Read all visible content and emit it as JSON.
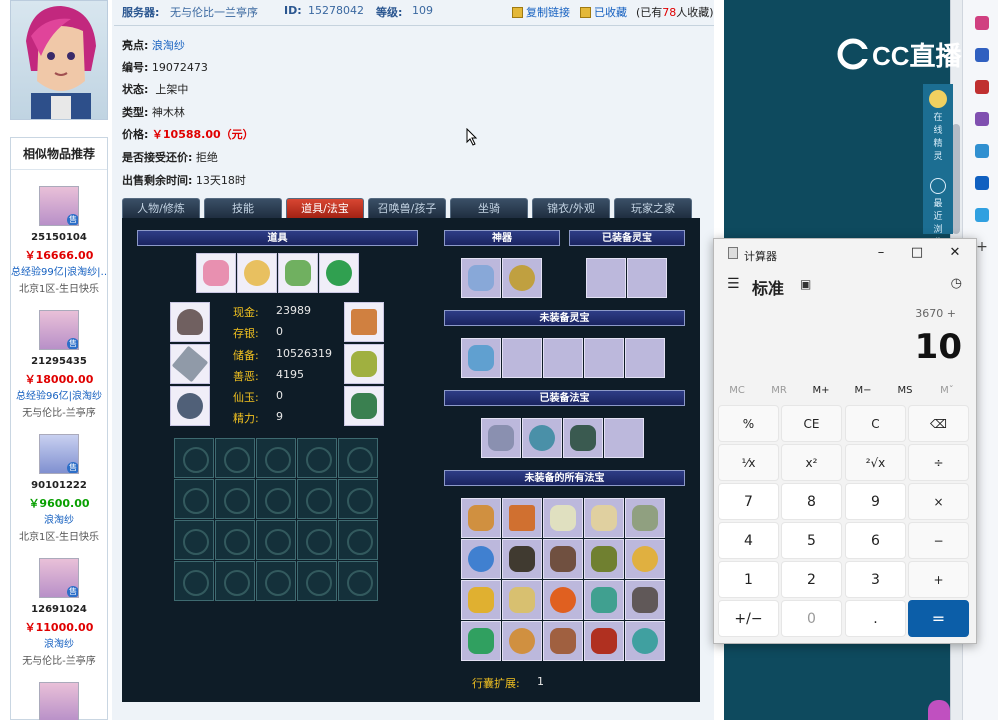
{
  "product": {
    "server_label": "服务器:",
    "server_value": "无与伦比一兰亭序",
    "id_label": "ID:",
    "id_value": "15278042",
    "level_label": "等级:",
    "level_value": "109",
    "copy_link": "复制链接",
    "favorited": "已收藏",
    "fav_prefix": "(已有",
    "fav_count": "78",
    "fav_suffix": "人收藏)",
    "highlight_label": "亮点:",
    "highlight_value": "浪淘纱",
    "number_label": "编号:",
    "number_value": "19072473",
    "status_label": "状态:",
    "status_value": "上架中",
    "type_label": "类型:",
    "type_value": "神木林",
    "price_label": "价格:",
    "price_value": "￥10588.00（元）",
    "bargain_label": "是否接受还价:",
    "bargain_value": "拒绝",
    "remaining_label": "出售剩余时间:",
    "remaining_value": "13天18时"
  },
  "similar": {
    "title": "相似物品推荐",
    "items": [
      {
        "id": "25150104",
        "price": "￥16666.00",
        "desc": "总经验99亿|浪淘纱|…",
        "server": "北京1区-生日快乐",
        "tag": "售",
        "price_color": "red"
      },
      {
        "id": "21295435",
        "price": "￥18000.00",
        "desc": "总经验96亿|浪淘纱",
        "server": "无与伦比-兰亭序",
        "tag": "售",
        "price_color": "red"
      },
      {
        "id": "90101222",
        "price": "￥9600.00",
        "desc": "浪淘纱",
        "server": "北京1区-生日快乐",
        "tag": "售",
        "price_color": "green"
      },
      {
        "id": "12691024",
        "price": "￥11000.00",
        "desc": "浪淘纱",
        "server": "无与伦比-兰亭序",
        "tag": "售",
        "price_color": "red"
      }
    ]
  },
  "tabs": [
    "人物/修炼",
    "技能",
    "道具/法宝",
    "召唤兽/孩子",
    "坐骑",
    "锦衣/外观",
    "玩家之家"
  ],
  "panel": {
    "items_header": "道具",
    "divine_header": "神器",
    "equipped_spirit_header": "已装备灵宝",
    "unequipped_spirit_header": "未装备灵宝",
    "equipped_treasure_header": "已装备法宝",
    "all_treasure_header": "未装备的所有法宝",
    "stats": [
      {
        "label": "现金:",
        "value": "23989"
      },
      {
        "label": "存银:",
        "value": "0"
      },
      {
        "label": "储备:",
        "value": "10526319"
      },
      {
        "label": "善恶:",
        "value": "4195"
      },
      {
        "label": "仙玉:",
        "value": "0"
      },
      {
        "label": "精力:",
        "value": "9"
      }
    ],
    "bag_label": "行囊扩展:",
    "bag_value": "1"
  },
  "side": {
    "logo": "CC直播",
    "sprite_label": "在线精灵",
    "recent_label": "最近浏览"
  },
  "calculator": {
    "title": "计算器",
    "mode": "标准",
    "expression": "3670 +",
    "display": "10",
    "memory": [
      "MC",
      "MR",
      "M+",
      "M−",
      "MS",
      "Mˇ"
    ],
    "keys": [
      [
        "%",
        "CE",
        "C",
        "⌫"
      ],
      [
        "¹⁄x",
        "x²",
        "²√x",
        "÷"
      ],
      [
        "7",
        "8",
        "9",
        "×"
      ],
      [
        "4",
        "5",
        "6",
        "−"
      ],
      [
        "1",
        "2",
        "3",
        "+"
      ],
      [
        "+/−",
        "0",
        ".",
        "="
      ]
    ]
  },
  "colors": {
    "accent_red": "#e00000",
    "calc_equals": "#0c5ea8",
    "panel_bg": "#0e1c27",
    "stat_label": "#f0c020"
  }
}
